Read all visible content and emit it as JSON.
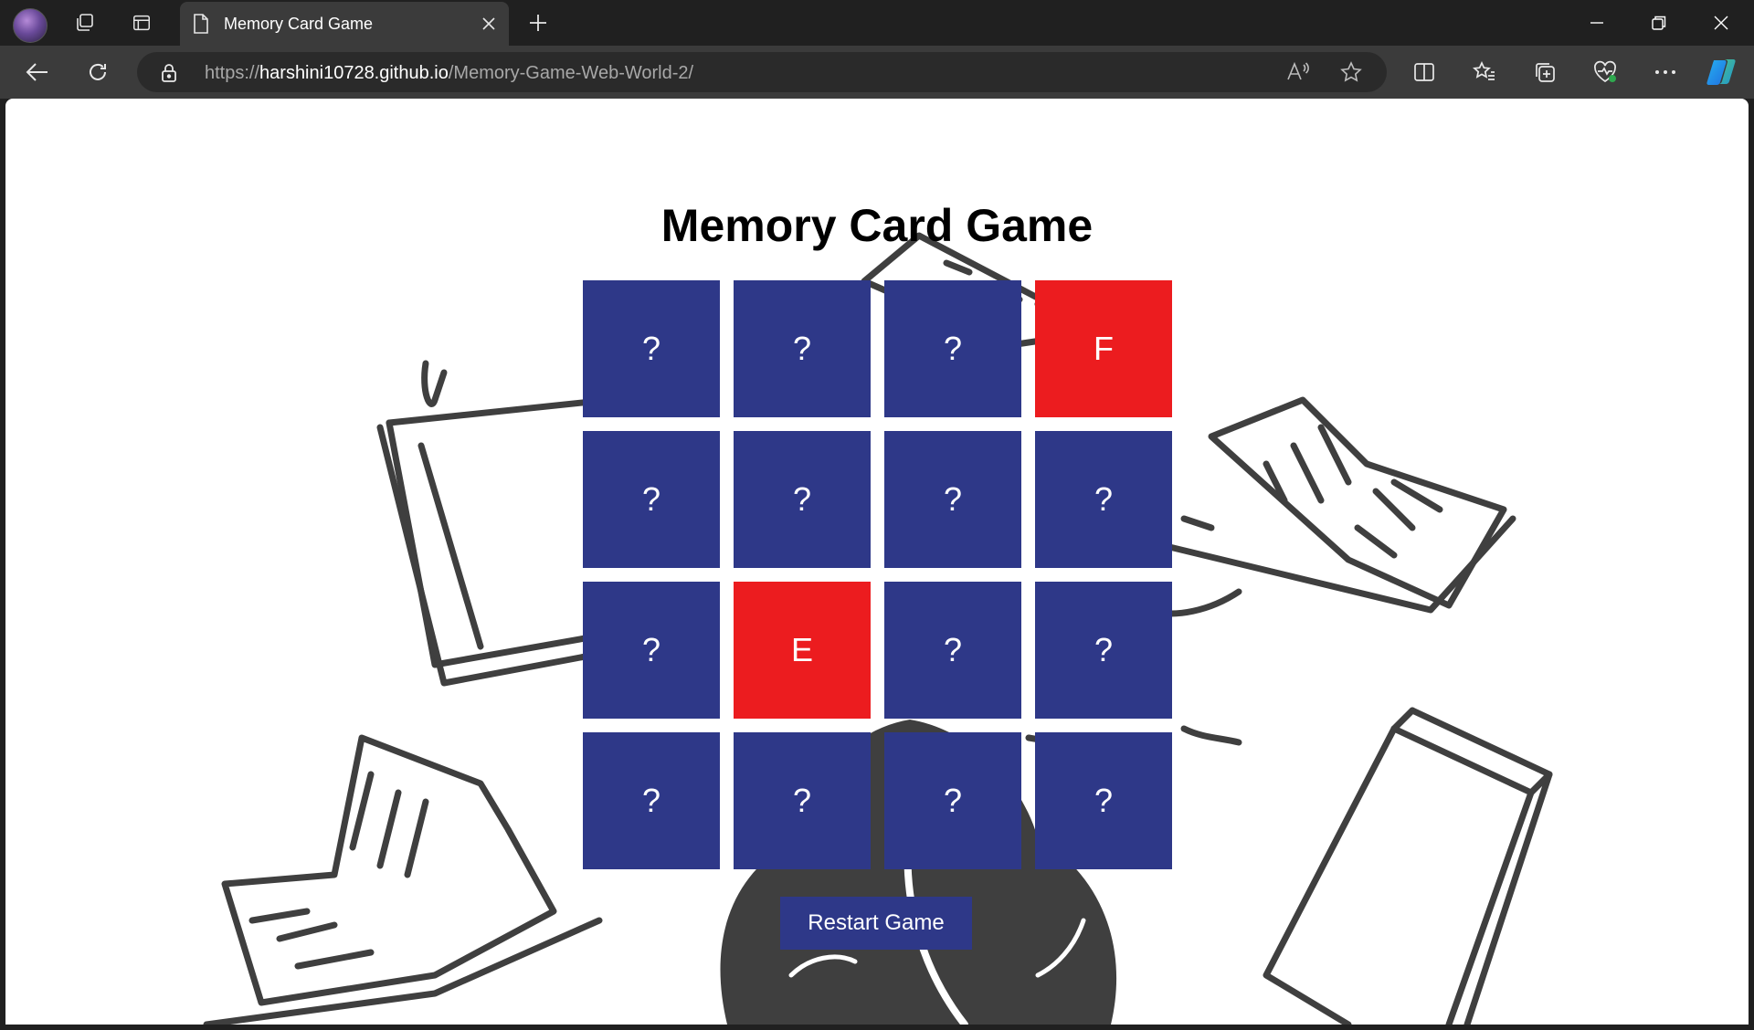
{
  "browser": {
    "tab": {
      "title": "Memory Card Game"
    },
    "url": {
      "scheme": "https://",
      "host": "harshini10728.github.io",
      "path": "/Memory-Game-Web-World-2/"
    }
  },
  "game": {
    "title": "Memory Card Game",
    "cards": [
      {
        "label": "?",
        "state": "hidden"
      },
      {
        "label": "?",
        "state": "hidden"
      },
      {
        "label": "?",
        "state": "hidden"
      },
      {
        "label": "F",
        "state": "flipped"
      },
      {
        "label": "?",
        "state": "hidden"
      },
      {
        "label": "?",
        "state": "hidden"
      },
      {
        "label": "?",
        "state": "hidden"
      },
      {
        "label": "?",
        "state": "hidden"
      },
      {
        "label": "?",
        "state": "hidden"
      },
      {
        "label": "E",
        "state": "flipped"
      },
      {
        "label": "?",
        "state": "hidden"
      },
      {
        "label": "?",
        "state": "hidden"
      },
      {
        "label": "?",
        "state": "hidden"
      },
      {
        "label": "?",
        "state": "hidden"
      },
      {
        "label": "?",
        "state": "hidden"
      },
      {
        "label": "?",
        "state": "hidden"
      }
    ],
    "restart_label": "Restart Game"
  },
  "colors": {
    "card_back": "#2e3888",
    "card_flipped": "#ec1c1f",
    "button": "#2e3888"
  }
}
